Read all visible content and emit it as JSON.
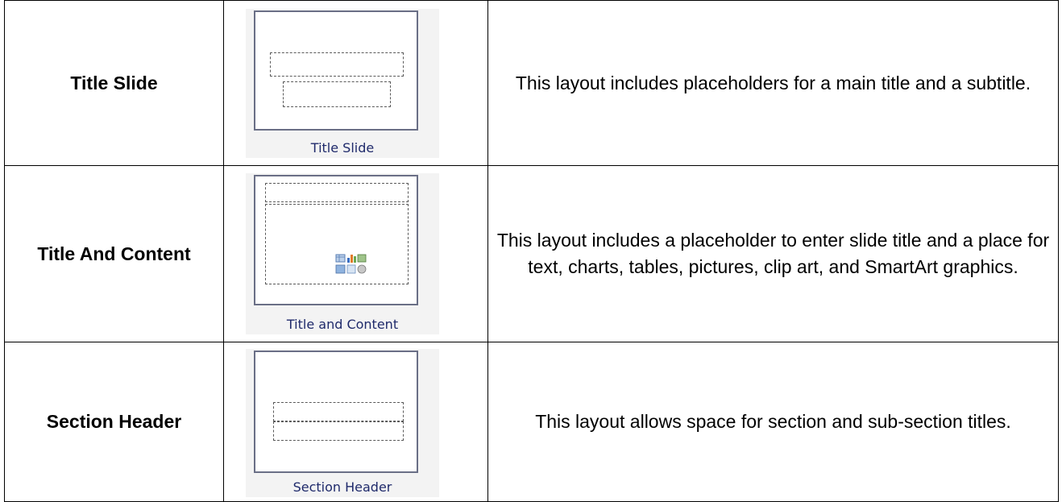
{
  "rows": [
    {
      "name": "Title Slide",
      "thumbnail_caption": "Title Slide",
      "description": "This layout includes placeholders for a main title and a subtitle."
    },
    {
      "name": "Title And Content",
      "thumbnail_caption": "Title and Content",
      "description": "This layout includes a placeholder to enter slide title and a place for text, charts, tables, pictures, clip art, and SmartArt graphics."
    },
    {
      "name": "Section Header",
      "thumbnail_caption": "Section Header",
      "description": "This layout allows space for section and sub-section titles."
    }
  ],
  "icons": {
    "content_placeholder": "insert-content-icon"
  },
  "colors": {
    "caption_text": "#1f2a6b",
    "slide_border": "#6a6f86",
    "thumb_background": "#f3f3f3"
  }
}
